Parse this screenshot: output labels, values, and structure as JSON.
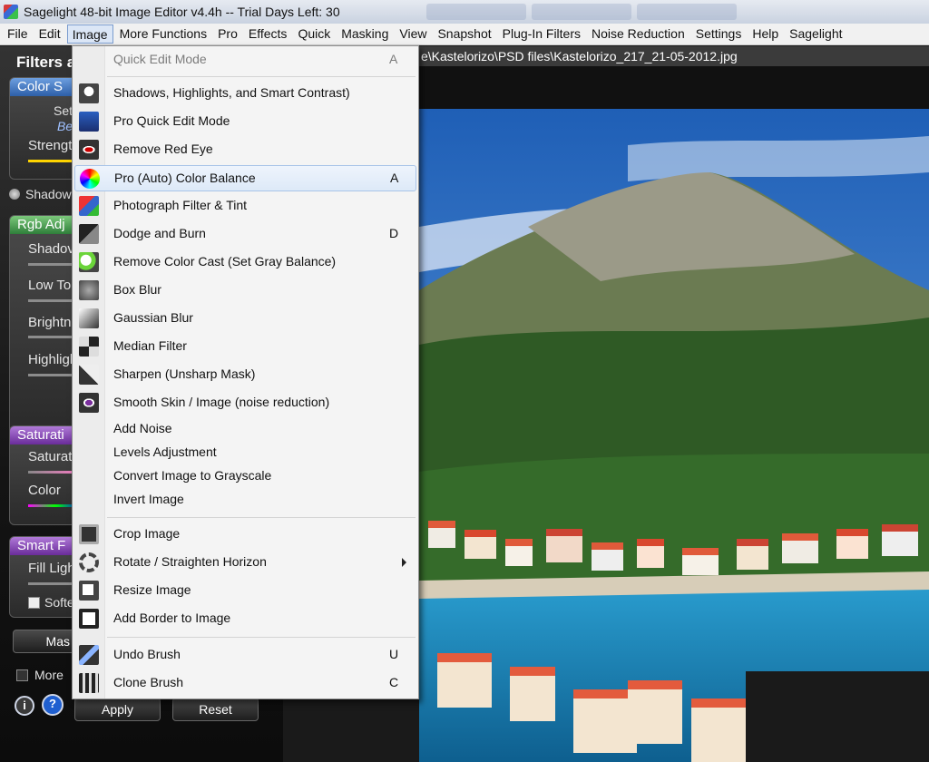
{
  "window": {
    "title": "Sagelight 48-bit Image Editor v4.4h -- Trial Days Left: 30"
  },
  "menubar": {
    "items": [
      "File",
      "Edit",
      "Image",
      "More Functions",
      "Pro",
      "Effects",
      "Quick",
      "Masking",
      "View",
      "Snapshot",
      "Plug-In Filters",
      "Noise Reduction",
      "Settings",
      "Help",
      "Sagelight"
    ],
    "active": "Image"
  },
  "filepath": "e\\Kastelorizo\\PSD files\\Kastelorizo_217_21-05-2012.jpg",
  "left_panel": {
    "title": "Filters a",
    "color_group": {
      "title": "Color S",
      "text1": "Set",
      "text2": "Be",
      "strength_label": "Strengt"
    },
    "shadow_radio_label": "Shadow",
    "rgb_group": {
      "title": "Rgb Adj",
      "sliders": [
        "Shadov",
        "Low To",
        "Brightn",
        "Highligl"
      ]
    },
    "saturation_group": {
      "title": "Saturati",
      "sliders": [
        "Saturat",
        "Color"
      ]
    },
    "smart_group": {
      "title": "Smart F",
      "fill_label": "Fill Ligh",
      "soften_label": "Softe"
    },
    "mask_button_label": "Mas",
    "more_label": "More",
    "apply_label": "Apply",
    "reset_label": "Reset",
    "info_icon_glyph": "i",
    "help_icon_glyph": "?"
  },
  "image_menu": {
    "items": [
      {
        "label": "Quick Edit Mode",
        "shortcut": "A",
        "disabled": true,
        "icon": null
      },
      {
        "label": "Shadows, Highlights, and Smart Contrast)",
        "icon": "lightbulb-icon"
      },
      {
        "label": "Pro Quick Edit Mode",
        "icon": "pro-quick-edit-icon"
      },
      {
        "label": "Remove Red Eye",
        "icon": "red-eye-icon"
      },
      {
        "label": "Pro (Auto) Color Balance",
        "shortcut": "A",
        "highlighted": true,
        "icon": "color-wheel-icon"
      },
      {
        "label": "Photograph Filter & Tint",
        "icon": "photo-filter-icon"
      },
      {
        "label": "Dodge and Burn",
        "shortcut": "D",
        "icon": "dodge-burn-icon"
      },
      {
        "label": "Remove Color Cast (Set Gray Balance)",
        "icon": "gray-balance-icon"
      },
      {
        "label": "Box Blur",
        "icon": "box-blur-icon"
      },
      {
        "label": "Gaussian Blur",
        "icon": "gaussian-blur-icon"
      },
      {
        "label": "Median Filter",
        "icon": "median-filter-icon"
      },
      {
        "label": "Sharpen (Unsharp Mask)",
        "icon": "sharpen-icon"
      },
      {
        "label": "Smooth Skin / Image (noise reduction)",
        "icon": "smooth-skin-icon"
      },
      {
        "label": "Add Noise"
      },
      {
        "label": "Levels Adjustment"
      },
      {
        "label": "Convert Image to Grayscale"
      },
      {
        "label": "Invert Image"
      },
      {
        "label": "Crop Image",
        "icon": "crop-icon"
      },
      {
        "label": "Rotate / Straighten Horizon",
        "submenu": true,
        "icon": "rotate-icon"
      },
      {
        "label": "Resize Image",
        "icon": "resize-icon"
      },
      {
        "label": "Add Border to Image",
        "icon": "border-icon"
      },
      {
        "label": "Undo Brush",
        "shortcut": "U",
        "icon": "undo-brush-icon"
      },
      {
        "label": "Clone Brush",
        "shortcut": "C",
        "icon": "clone-brush-icon"
      }
    ]
  },
  "colors": {
    "menu_highlight": "#dde9f8",
    "panel_accent": "#2d5fa8",
    "sky": "#2c6fbf",
    "sea": "#1b8fc2"
  }
}
